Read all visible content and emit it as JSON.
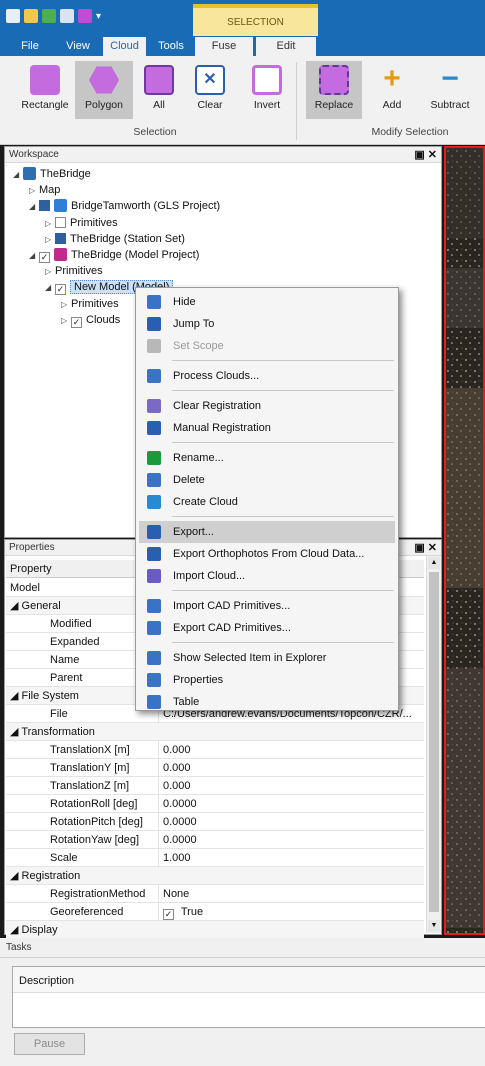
{
  "ribbon": {
    "contextual_group": "SELECTION",
    "tabs": [
      "File",
      "View",
      "Cloud",
      "Tools",
      "Fuse",
      "Edit"
    ],
    "active_tab": "Cloud",
    "selection_buttons": [
      {
        "label": "Rectangle",
        "icon": "rectangle-select-icon",
        "selected": false
      },
      {
        "label": "Polygon",
        "icon": "polygon-select-icon",
        "selected": true
      },
      {
        "label": "All",
        "icon": "select-all-icon",
        "selected": false
      },
      {
        "label": "Clear",
        "icon": "clear-selection-icon",
        "selected": false
      },
      {
        "label": "Invert",
        "icon": "invert-selection-icon",
        "selected": false
      }
    ],
    "selection_group_label": "Selection",
    "modify_buttons": [
      {
        "label": "Replace",
        "icon": "replace-icon",
        "selected": true
      },
      {
        "label": "Add",
        "icon": "add-icon",
        "selected": false
      },
      {
        "label": "Subtract",
        "icon": "subtract-icon",
        "selected": false
      }
    ],
    "modify_group_label": "Modify Selection"
  },
  "workspace": {
    "title": "Workspace",
    "controls": "▣ ✕",
    "tree": [
      {
        "label": "TheBridge",
        "depth": 0,
        "expander": "◢",
        "icon": "project-icon"
      },
      {
        "label": "Map",
        "depth": 1,
        "expander": "▷"
      },
      {
        "label": "BridgeTamworth (GLS Project)",
        "depth": 1,
        "expander": "◢",
        "checkbox": "filled",
        "icon": "scanner-project-icon"
      },
      {
        "label": "Primitives",
        "depth": 2,
        "expander": "▷",
        "checkbox": "empty"
      },
      {
        "label": "TheBridge (Station Set)",
        "depth": 2,
        "expander": "▷",
        "checkbox": "filled"
      },
      {
        "label": "TheBridge (Model Project)",
        "depth": 1,
        "expander": "◢",
        "checkbox": "checked",
        "icon": "model-project-icon"
      },
      {
        "label": "Primitives",
        "depth": 2,
        "expander": "▷"
      },
      {
        "label": "New Model (Model)",
        "depth": 2,
        "expander": "◢",
        "checkbox": "checked",
        "selected": true
      },
      {
        "label": "Primitives",
        "depth": 3,
        "expander": "▷"
      },
      {
        "label": "Clouds",
        "depth": 3,
        "expander": "▷",
        "checkbox": "checked"
      }
    ]
  },
  "context_menu": {
    "items": [
      {
        "label": "Hide",
        "icon": "hide-icon",
        "color": "#3b73c4"
      },
      {
        "label": "Jump To",
        "icon": "jump-to-icon",
        "color": "#2a5fb0"
      },
      {
        "label": "Set Scope",
        "icon": "set-scope-icon",
        "color": "#b8b8b8",
        "disabled": true
      },
      {
        "sep": true
      },
      {
        "label": "Process Clouds...",
        "icon": "process-clouds-icon",
        "color": "#3b73c4"
      },
      {
        "sep": true
      },
      {
        "label": "Clear Registration",
        "icon": "clear-registration-icon",
        "color": "#7a6ac4"
      },
      {
        "label": "Manual Registration",
        "icon": "manual-registration-icon",
        "color": "#2a5fb0"
      },
      {
        "sep": true
      },
      {
        "label": "Rename...",
        "icon": "rename-icon",
        "color": "#1a9a3a"
      },
      {
        "label": "Delete",
        "icon": "delete-icon",
        "color": "#3b73c4"
      },
      {
        "label": "Create Cloud",
        "icon": "create-cloud-icon",
        "color": "#2a8ad0"
      },
      {
        "sep": true
      },
      {
        "label": "Export...",
        "icon": "export-icon",
        "color": "#2a5fb0",
        "highlighted": true
      },
      {
        "label": "Export Orthophotos From Cloud Data...",
        "icon": "export-orthophotos-icon",
        "color": "#2a5fb0"
      },
      {
        "label": "Import Cloud...",
        "icon": "import-cloud-icon",
        "color": "#6a5ac4"
      },
      {
        "sep": true
      },
      {
        "label": "Import CAD Primitives...",
        "icon": "import-cad-icon",
        "color": "#3b73c4"
      },
      {
        "label": "Export CAD Primitives...",
        "icon": "export-cad-icon",
        "color": "#3b73c4"
      },
      {
        "sep": true
      },
      {
        "label": "Show Selected Item in Explorer",
        "icon": "explorer-icon",
        "color": "#3b73c4"
      },
      {
        "label": "Properties",
        "icon": "properties-icon",
        "color": "#3b73c4"
      },
      {
        "label": "Table",
        "icon": "table-icon",
        "color": "#3b73c4"
      }
    ]
  },
  "properties": {
    "title": "Properties",
    "controls": "▣ ✕",
    "column_header": "Property",
    "object": "Model",
    "rows": [
      {
        "cat": "General"
      },
      {
        "name": "Modified",
        "value": ""
      },
      {
        "name": "Expanded",
        "value": ""
      },
      {
        "name": "Name",
        "value": ""
      },
      {
        "name": "Parent",
        "value": ""
      },
      {
        "cat": "File System"
      },
      {
        "name": "File",
        "value": "C:/Users/andrew.evans/Documents/Topcon/CZR/..."
      },
      {
        "cat": "Transformation"
      },
      {
        "name": "TranslationX [m]",
        "value": "0.000"
      },
      {
        "name": "TranslationY [m]",
        "value": "0.000"
      },
      {
        "name": "TranslationZ [m]",
        "value": "0.000"
      },
      {
        "name": "RotationRoll [deg]",
        "value": "0.0000"
      },
      {
        "name": "RotationPitch [deg]",
        "value": "0.0000"
      },
      {
        "name": "RotationYaw [deg]",
        "value": "0.0000"
      },
      {
        "name": "Scale",
        "value": "1.000"
      },
      {
        "cat": "Registration"
      },
      {
        "name": "RegistrationMethod",
        "value": "None"
      },
      {
        "name": "Georeferenced",
        "value": "True",
        "checkbox": true
      },
      {
        "cat": "Display"
      }
    ]
  },
  "tasks": {
    "title": "Tasks",
    "column_header": "Description",
    "pause_label": "Pause"
  },
  "colors": {
    "accent": "#1a6bb5",
    "viewport_border": "#e02020",
    "selection_ctx": "#f7e69c"
  }
}
